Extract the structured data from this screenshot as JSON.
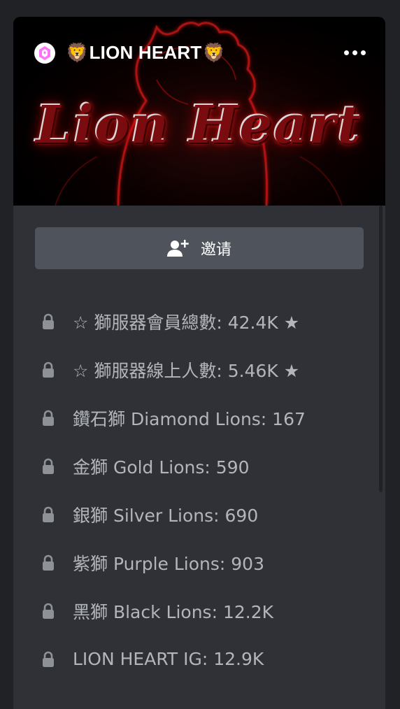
{
  "server": {
    "name": "LION HEART",
    "name_prefix_emoji": "🦁",
    "name_suffix_emoji": "🦁",
    "banner_text": "Lion Heart",
    "boost_icon": "boost-gem-icon",
    "menu_icon": "more-icon"
  },
  "invite": {
    "label": "邀请",
    "icon": "add-person-icon"
  },
  "channels": [
    {
      "name": "☆ 獅服器會員總數: 42.4K ★",
      "icon": "lock-icon"
    },
    {
      "name": "☆ 獅服器線上人數: 5.46K ★",
      "icon": "lock-icon"
    },
    {
      "name": "鑽石獅 Diamond Lions: 167",
      "icon": "lock-icon"
    },
    {
      "name": "金獅 Gold Lions: 590",
      "icon": "lock-icon"
    },
    {
      "name": "銀獅 Silver Lions: 690",
      "icon": "lock-icon"
    },
    {
      "name": "紫獅 Purple Lions: 903",
      "icon": "lock-icon"
    },
    {
      "name": "黑獅 Black Lions: 12.2K",
      "icon": "lock-icon"
    },
    {
      "name": "LION HEART IG: 12.9K",
      "icon": "lock-icon"
    }
  ],
  "colors": {
    "background": "#202225",
    "panel": "#2f3136",
    "button": "#4f545c",
    "channel_text": "#b2b5ba",
    "banner_accent": "#c81414"
  }
}
